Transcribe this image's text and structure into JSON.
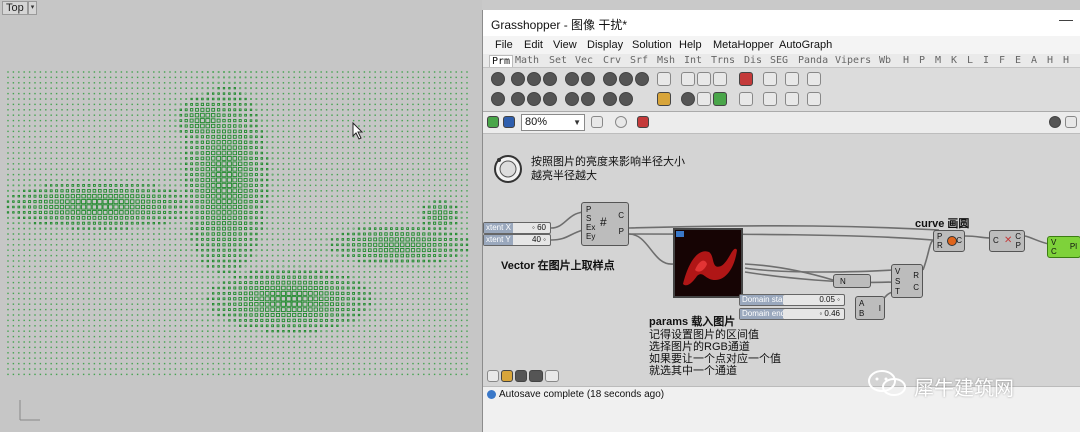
{
  "viewport": {
    "label": "Top"
  },
  "gh": {
    "title": "Grasshopper - 图像 干扰*",
    "menu": [
      "File",
      "Edit",
      "View",
      "Display",
      "Solution",
      "Help",
      "MetaHopper",
      "AutoGraph"
    ],
    "tabs": [
      "Prm",
      "Math",
      "Set",
      "Vec",
      "Crv",
      "Srf",
      "Msh",
      "Int",
      "Trns",
      "Dis",
      "SEG",
      "Panda",
      "Vipers",
      "Wb",
      "H",
      "P",
      "M",
      "K",
      "L",
      "I",
      "F",
      "E",
      "A",
      "H",
      "H"
    ],
    "active_tab": "Prm",
    "zoom": "80%",
    "canvas": {
      "note1_line1": "按照图片的亮度来影响半径大小",
      "note1_line2": "越亮半径越大",
      "note_vector": "Vector 在图片上取样点",
      "note_curve": "curve 画圆",
      "note_params_1": "params 载入图片",
      "note_params_2": "记得设置图片的区间值",
      "note_params_3": "选择图片的RGB通道",
      "note_params_4": "如果要让一个点对应一个值",
      "note_params_5": "就选其中一个通道",
      "slider_extent_x_label": "xtent X",
      "slider_extent_x_value": "◦ 60",
      "slider_extent_y_label": "xtent Y",
      "slider_extent_y_value": "40 ◦",
      "slider_domain_start_label": "Domain start",
      "slider_domain_start_value": "0.05 ◦",
      "slider_domain_end_label": "Domain end",
      "slider_domain_end_value": "◦ 0.46",
      "comp_grid_inputs": [
        "P",
        "S",
        "Ex",
        "Ey"
      ],
      "comp_grid_outputs": [
        "C",
        "P"
      ],
      "comp_circle_inputs": [
        "P",
        "R"
      ],
      "comp_circle_output": "C",
      "comp_N": "N",
      "comp_remap_inputs": [
        "V",
        "S",
        "T"
      ],
      "comp_remap_outputs": [
        "R",
        "C"
      ],
      "comp_domain_inputs": [
        "A",
        "B"
      ],
      "comp_domain_output": "I",
      "comp_c_input": "C",
      "comp_c_outputs": [
        "C",
        "P"
      ],
      "comp_final_inputs": [
        "V",
        "C"
      ],
      "comp_final_output": "Pl"
    },
    "status": "Autosave complete (18 seconds ago)"
  },
  "watermark": {
    "text": "犀牛建筑网"
  }
}
